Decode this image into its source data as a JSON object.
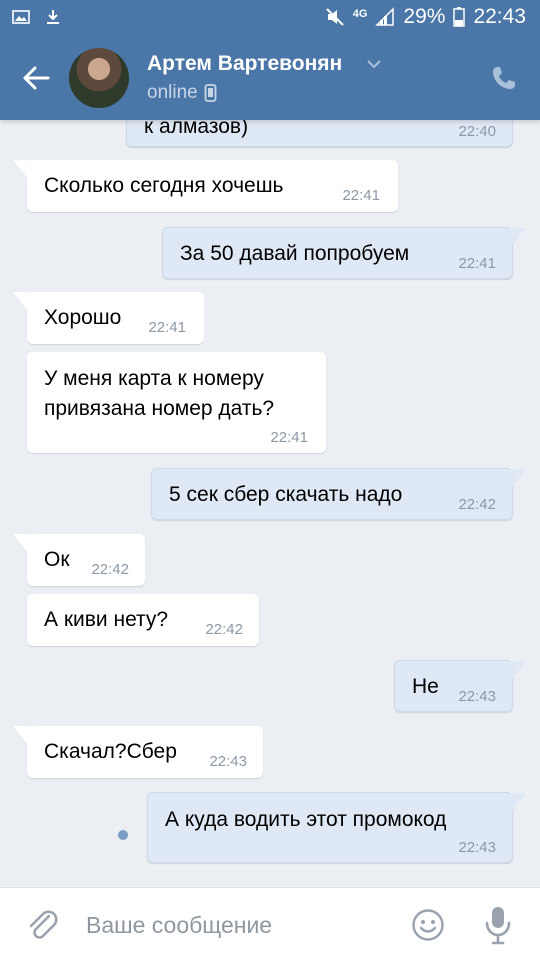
{
  "status_bar": {
    "network": "4G",
    "battery": "29%",
    "time": "22:43"
  },
  "header": {
    "name": "Артем Вартевонян",
    "status": "online"
  },
  "messages": [
    {
      "dir": "out",
      "text": "к алмазов)",
      "time": "22:40"
    },
    {
      "dir": "in",
      "text": "Сколько сегодня хочешь",
      "time": "22:41"
    },
    {
      "dir": "out",
      "text": "За 50 давай попробуем",
      "time": "22:41"
    },
    {
      "dir": "in",
      "text": "Хорошо",
      "time": "22:41"
    },
    {
      "dir": "in",
      "text": "У меня карта к номеру\nпривязана номер дать?",
      "time": "22:41"
    },
    {
      "dir": "out",
      "text": "5 сек сбер скачать надо",
      "time": "22:42"
    },
    {
      "dir": "in",
      "text": "Ок",
      "time": "22:42"
    },
    {
      "dir": "in",
      "text": "А киви нету?",
      "time": "22:42"
    },
    {
      "dir": "out",
      "text": "Не",
      "time": "22:43"
    },
    {
      "dir": "in",
      "text": "Скачал?Сбер",
      "time": "22:43"
    },
    {
      "dir": "out",
      "text": "А куда водить этот промокод",
      "time": "22:43",
      "unread": true
    }
  ],
  "input": {
    "placeholder": "Ваше сообщение"
  },
  "colors": {
    "header": "#4a76a8",
    "incoming": "#ffffff",
    "outgoing": "#dfe8f5",
    "background": "#ebeef3"
  }
}
